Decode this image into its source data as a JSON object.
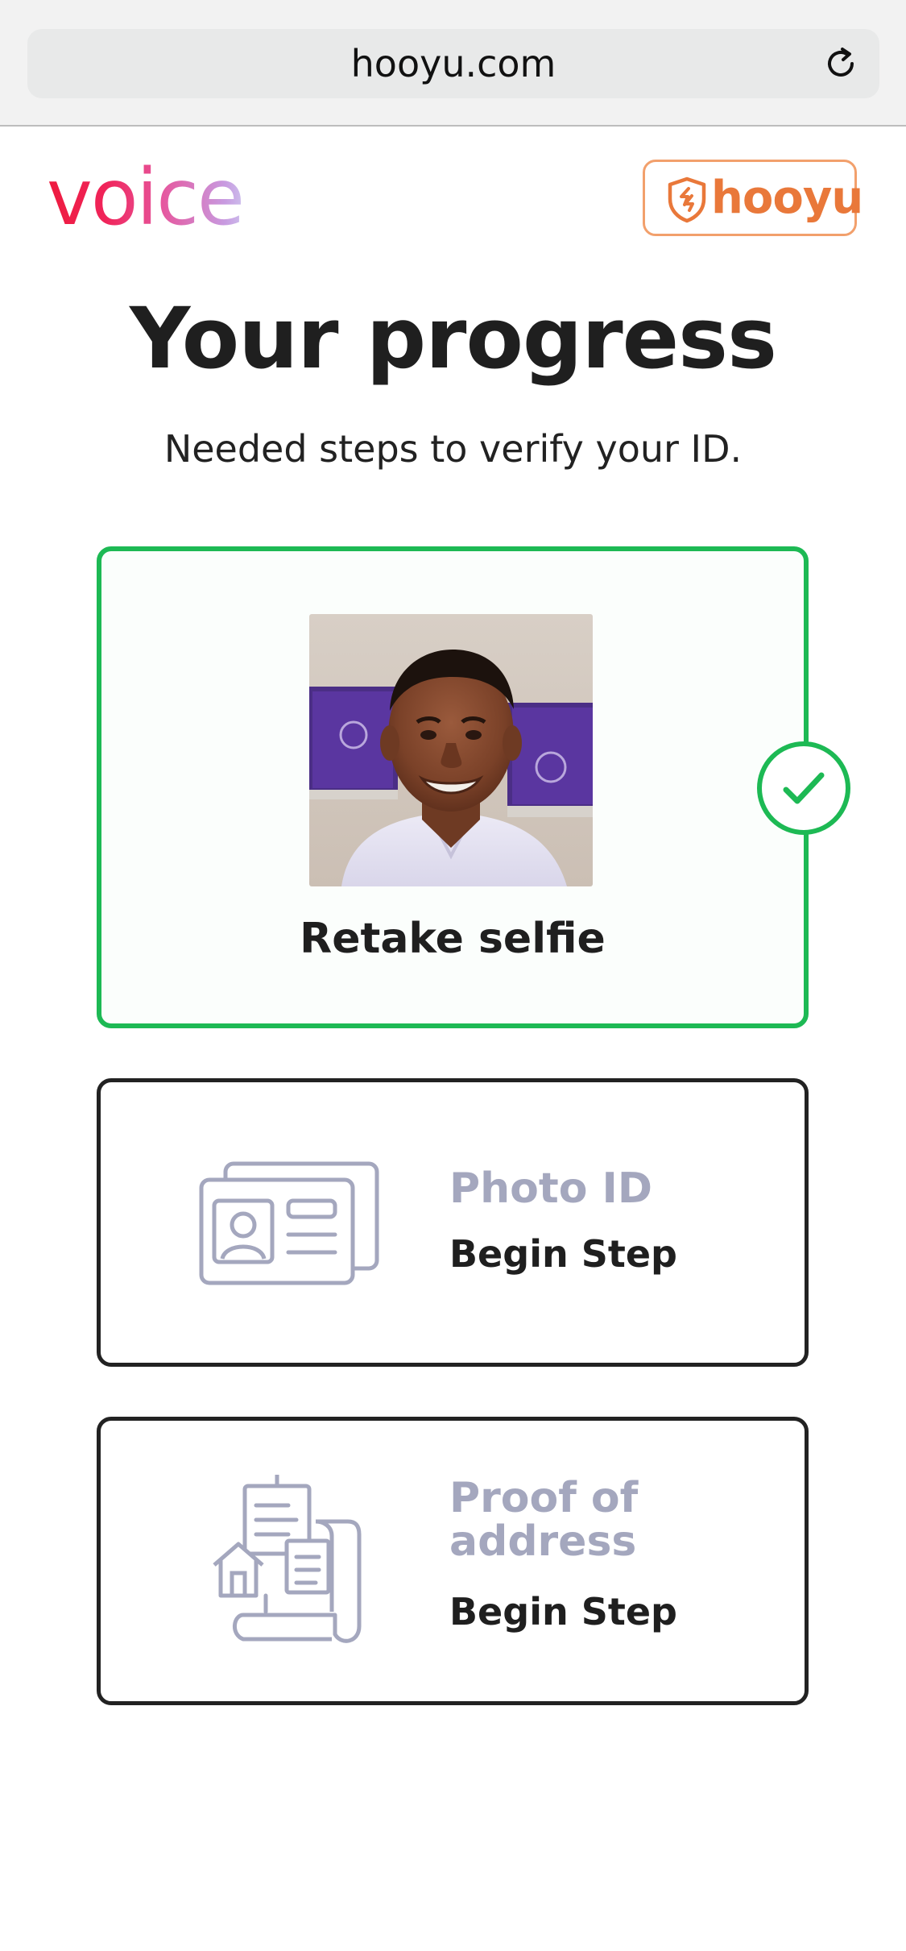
{
  "browser": {
    "url": "hooyu.com"
  },
  "header": {
    "brand_logo_text": "voice",
    "partner_logo_text": "hooyu"
  },
  "page": {
    "title": "Your progress",
    "subtitle": "Needed steps to verify your ID."
  },
  "steps": [
    {
      "label": "Retake selfie",
      "status": "completed",
      "icon": "check-icon"
    },
    {
      "title": "Photo ID",
      "action": "Begin Step",
      "icon": "id-card-icon"
    },
    {
      "title_line1": "Proof of",
      "title_line2": "address",
      "action": "Begin Step",
      "icon": "address-documents-icon"
    }
  ],
  "colors": {
    "success": "#1db954",
    "card_border": "#222222",
    "muted_title": "#a4a7be",
    "hooyu_orange": "#e9783a",
    "voice_red": "#ee1b3e"
  }
}
